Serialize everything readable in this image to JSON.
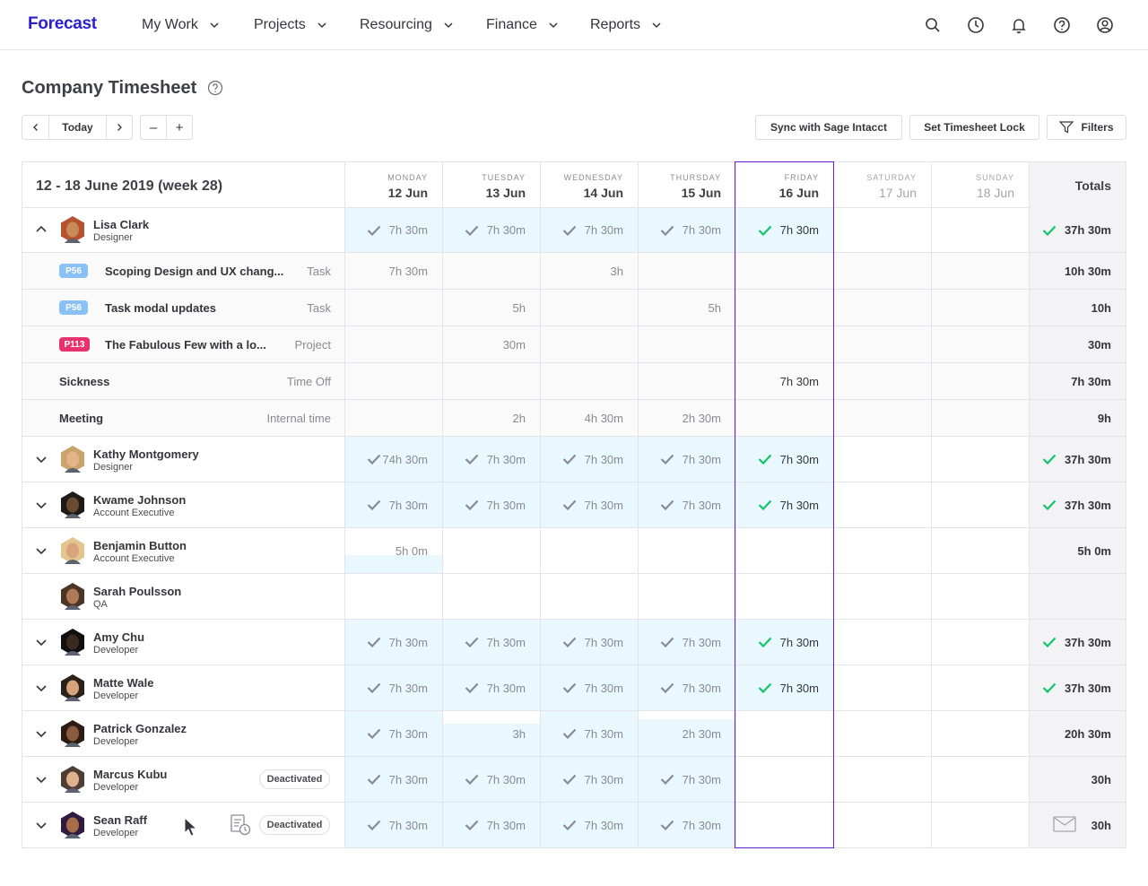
{
  "nav": {
    "logo": "Forecast",
    "items": [
      "My Work",
      "Projects",
      "Resourcing",
      "Finance",
      "Reports"
    ]
  },
  "page": {
    "title": "Company Timesheet"
  },
  "toolbar": {
    "today": "Today",
    "zoom_out": "–",
    "zoom_in": "+",
    "sync": "Sync with Sage Intacct",
    "lock": "Set Timesheet Lock",
    "filters": "Filters"
  },
  "table": {
    "week": "12 - 18 June 2019 (week 28)",
    "totals_label": "Totals",
    "days": [
      {
        "name": "MONDAY",
        "date": "12 Jun"
      },
      {
        "name": "TUESDAY",
        "date": "13 Jun"
      },
      {
        "name": "WEDNESDAY",
        "date": "14 Jun"
      },
      {
        "name": "THURSDAY",
        "date": "15 Jun"
      },
      {
        "name": "FRIDAY",
        "date": "16 Jun"
      },
      {
        "name": "SATURDAY",
        "date": "17 Jun"
      },
      {
        "name": "SUNDAY",
        "date": "18 Jun"
      }
    ],
    "expanded_person": {
      "name": "Lisa Clark",
      "role": "Designer",
      "days": [
        "7h 30m",
        "7h 30m",
        "7h 30m",
        "7h 30m",
        "7h 30m",
        "",
        ""
      ],
      "total": "37h 30m"
    },
    "sub_rows": [
      {
        "tag": "P56",
        "tag_color": "#8ac1f5",
        "name": "Scoping Design and UX chang...",
        "type": "Task",
        "days": [
          "7h 30m",
          "",
          "3h",
          "",
          "",
          "",
          ""
        ],
        "total": "10h 30m"
      },
      {
        "tag": "P56",
        "tag_color": "#8ac1f5",
        "name": "Task modal updates",
        "type": "Task",
        "days": [
          "",
          "5h",
          "",
          "5h",
          "",
          "",
          ""
        ],
        "total": "10h"
      },
      {
        "tag": "P113",
        "tag_color": "#e6336d",
        "name": "The Fabulous Few with a lo...",
        "type": "Project",
        "days": [
          "",
          "30m",
          "",
          "",
          "",
          "",
          ""
        ],
        "total": "30m"
      },
      {
        "tag": "",
        "tag_color": "",
        "name": "Sickness",
        "type": "Time Off",
        "days": [
          "",
          "",
          "",
          "",
          "7h 30m",
          "",
          ""
        ],
        "total": "7h 30m"
      },
      {
        "tag": "",
        "tag_color": "",
        "name": "Meeting",
        "type": "Internal time",
        "days": [
          "",
          "2h",
          "4h 30m",
          "2h 30m",
          "",
          "",
          ""
        ],
        "total": "9h"
      }
    ],
    "people": [
      {
        "name": "Kathy Montgomery",
        "role": "Designer",
        "days": [
          "74h 30m",
          "7h 30m",
          "7h 30m",
          "7h 30m",
          "7h 30m",
          "",
          ""
        ],
        "total": "37h 30m",
        "badge": ""
      },
      {
        "name": "Kwame Johnson",
        "role": "Account Executive",
        "days": [
          "7h 30m",
          "7h 30m",
          "7h 30m",
          "7h 30m",
          "7h 30m",
          "",
          ""
        ],
        "total": "37h 30m",
        "badge": ""
      },
      {
        "name": "Benjamin Button",
        "role": "Account Executive",
        "days": [
          "5h 0m",
          "",
          "",
          "",
          "",
          "",
          ""
        ],
        "total": "5h 0m",
        "badge": ""
      },
      {
        "name": "Sarah Poulsson",
        "role": "QA",
        "days": [
          "",
          "",
          "",
          "",
          "",
          "",
          ""
        ],
        "total": "",
        "badge": ""
      },
      {
        "name": "Amy Chu",
        "role": "Developer",
        "days": [
          "7h 30m",
          "7h 30m",
          "7h 30m",
          "7h 30m",
          "7h 30m",
          "",
          ""
        ],
        "total": "37h 30m",
        "badge": ""
      },
      {
        "name": "Matte Wale",
        "role": "Developer",
        "days": [
          "7h 30m",
          "7h 30m",
          "7h 30m",
          "7h 30m",
          "7h 30m",
          "",
          ""
        ],
        "total": "37h 30m",
        "badge": ""
      },
      {
        "name": "Patrick Gonzalez",
        "role": "Developer",
        "days": [
          "7h 30m",
          "3h",
          "7h 30m",
          "2h 30m",
          "",
          "",
          ""
        ],
        "total": "20h 30m",
        "badge": ""
      },
      {
        "name": "Marcus Kubu",
        "role": "Developer",
        "days": [
          "7h 30m",
          "7h 30m",
          "7h 30m",
          "7h 30m",
          "",
          "",
          ""
        ],
        "total": "30h",
        "badge": "Deactivated"
      },
      {
        "name": "Sean Raff",
        "role": "Developer",
        "days": [
          "7h 30m",
          "7h 30m",
          "7h 30m",
          "7h 30m",
          "",
          "",
          ""
        ],
        "total": "30h",
        "badge": "Deactivated"
      }
    ]
  },
  "colors": {
    "brand": "#2b1ed1",
    "approved_check": "#12c46a",
    "pending_check": "#8a8a94",
    "filled_cell": "#e9f7fe",
    "friday_outline": "#6a1be0"
  }
}
